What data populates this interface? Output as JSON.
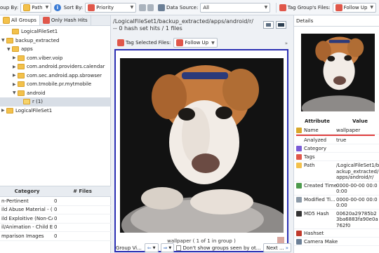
{
  "toolbar": {
    "group_by_label": "oup By:",
    "group_by_value": "Path",
    "sort_by_label": "Sort By:",
    "sort_by_value": "Priority",
    "data_source_label": "Data Source:",
    "data_source_value": "All",
    "tag_group_label": "Tag Group's Files:",
    "tag_group_value": "Follow Up"
  },
  "left_panel": {
    "tabs": [
      "All Groups",
      "Only Hash Hits"
    ],
    "tree": [
      {
        "label": "LogicalFileSet1",
        "indent": 1,
        "expanded": null
      },
      {
        "label": "backup_extracted",
        "indent": 0,
        "expanded": true
      },
      {
        "label": "apps",
        "indent": 1,
        "expanded": true
      },
      {
        "label": "com.viber.voip",
        "indent": 2,
        "expanded": false
      },
      {
        "label": "com.android.providers.calendar",
        "indent": 2,
        "expanded": false
      },
      {
        "label": "com.sec.android.app.sbrowser",
        "indent": 2,
        "expanded": false
      },
      {
        "label": "com.tmobile.pr.mytmobile",
        "indent": 2,
        "expanded": false
      },
      {
        "label": "android",
        "indent": 2,
        "expanded": true
      },
      {
        "label": "r (1)",
        "indent": 3,
        "expanded": null,
        "selected": true
      },
      {
        "label": "LogicalFileSet1",
        "indent": 0,
        "expanded": false
      }
    ],
    "category_table": {
      "headers": [
        "Category",
        "# Files"
      ],
      "rows": [
        [
          "n-Pertinent",
          "0"
        ],
        [
          "ild Abuse Material - (...",
          "0"
        ],
        [
          "ild Exploitive (Non-CA...",
          "0"
        ],
        [
          "il/Animation - Child Ex...",
          "0"
        ],
        [
          "mparison Images",
          "0"
        ]
      ]
    }
  },
  "center": {
    "path_text": "/LogicalFileSet1/backup_extracted/apps/android/r/ -- 0 hash set hits / 1 files",
    "tag_selected_label": "Tag Selected Files:",
    "follow_up_label": "Follow Up",
    "overflow_label": "»",
    "tile_caption": "wallpaper  ( 1 of 1 in group )",
    "group_viewed_label": "Group Vi...",
    "dont_show_label": "Don't show groups seen by ot...",
    "next_label": "Next ..."
  },
  "details": {
    "title": "Details",
    "headers": [
      "Attribute",
      "Value"
    ],
    "rows": [
      {
        "attribute": "Name",
        "value": "wallpaper",
        "icon_color": "#d9a82b"
      },
      {
        "attribute": "Analyzed",
        "value": "true",
        "icon_color": ""
      },
      {
        "attribute": "Category",
        "value": "",
        "icon_color": "#7a5bd6"
      },
      {
        "attribute": "Tags",
        "value": "",
        "icon_color": "#e0574a"
      },
      {
        "attribute": "Path",
        "value": "/LogicalFileSet1/backup_extracted/apps/android/r/",
        "icon_color": "#f3c14b"
      },
      {
        "attribute": "Created Time",
        "value": "0000-00-00 00:00:00",
        "icon_color": "#4c9a4c"
      },
      {
        "attribute": "Modified Ti...",
        "value": "0000-00-00 00:00:00",
        "icon_color": "#8c9aa8"
      },
      {
        "attribute": "MD5 Hash",
        "value": "00620a29785b23ba6883fa90e0a762f0",
        "icon_color": "#333333"
      },
      {
        "attribute": "Hashset",
        "value": "",
        "icon_color": "#c0392b"
      },
      {
        "attribute": "Camera Make",
        "value": "",
        "icon_color": "#6b7f96"
      }
    ]
  },
  "colors": {
    "selection_border": "#2b2fb3",
    "accent_red": "#e04040"
  }
}
